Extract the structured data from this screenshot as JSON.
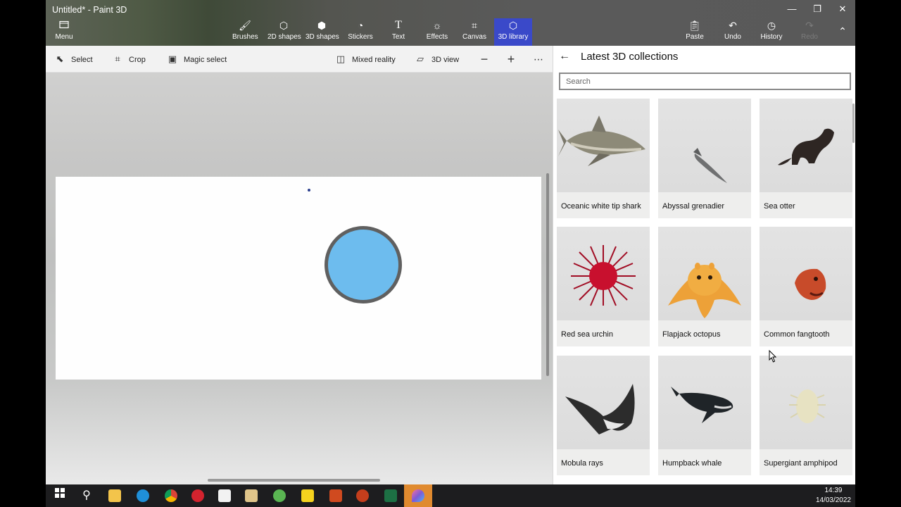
{
  "window": {
    "title": "Untitled* - Paint 3D",
    "controls": {
      "minimize": "—",
      "maximize": "❐",
      "close": "✕"
    }
  },
  "ribbon": {
    "menu": "Menu",
    "brushes": "Brushes",
    "shapes2d": "2D shapes",
    "shapes3d": "3D shapes",
    "stickers": "Stickers",
    "text": "Text",
    "effects": "Effects",
    "canvas": "Canvas",
    "library3d": "3D library",
    "paste": "Paste",
    "undo": "Undo",
    "history": "History",
    "redo": "Redo",
    "active_tab": "3D library",
    "accent_color": "#3a49c9"
  },
  "toolbar": {
    "select": "Select",
    "crop": "Crop",
    "magic_select": "Magic select",
    "mixed_reality": "Mixed reality",
    "view3d": "3D view"
  },
  "canvas": {
    "background": "#fefefe",
    "circle_fill": "#6dbcee",
    "circle_stroke": "#606060"
  },
  "panel": {
    "title": "Latest 3D collections",
    "search_placeholder": "Search",
    "items": [
      {
        "label": "Oceanic white tip shark"
      },
      {
        "label": "Abyssal grenadier"
      },
      {
        "label": "Sea otter"
      },
      {
        "label": "Red sea urchin"
      },
      {
        "label": "Flapjack octopus"
      },
      {
        "label": "Common fangtooth"
      },
      {
        "label": "Mobula rays"
      },
      {
        "label": "Humpback whale"
      },
      {
        "label": "Supergiant amphipod"
      }
    ]
  },
  "taskbar": {
    "apps": [
      "windows-start",
      "search",
      "file-explorer",
      "edge",
      "chrome",
      "opera",
      "store",
      "media-player",
      "chat",
      "sticky-notes",
      "office",
      "powerpoint",
      "excel",
      "paint3d"
    ],
    "time": "14:39",
    "date": "14/03/2022"
  }
}
